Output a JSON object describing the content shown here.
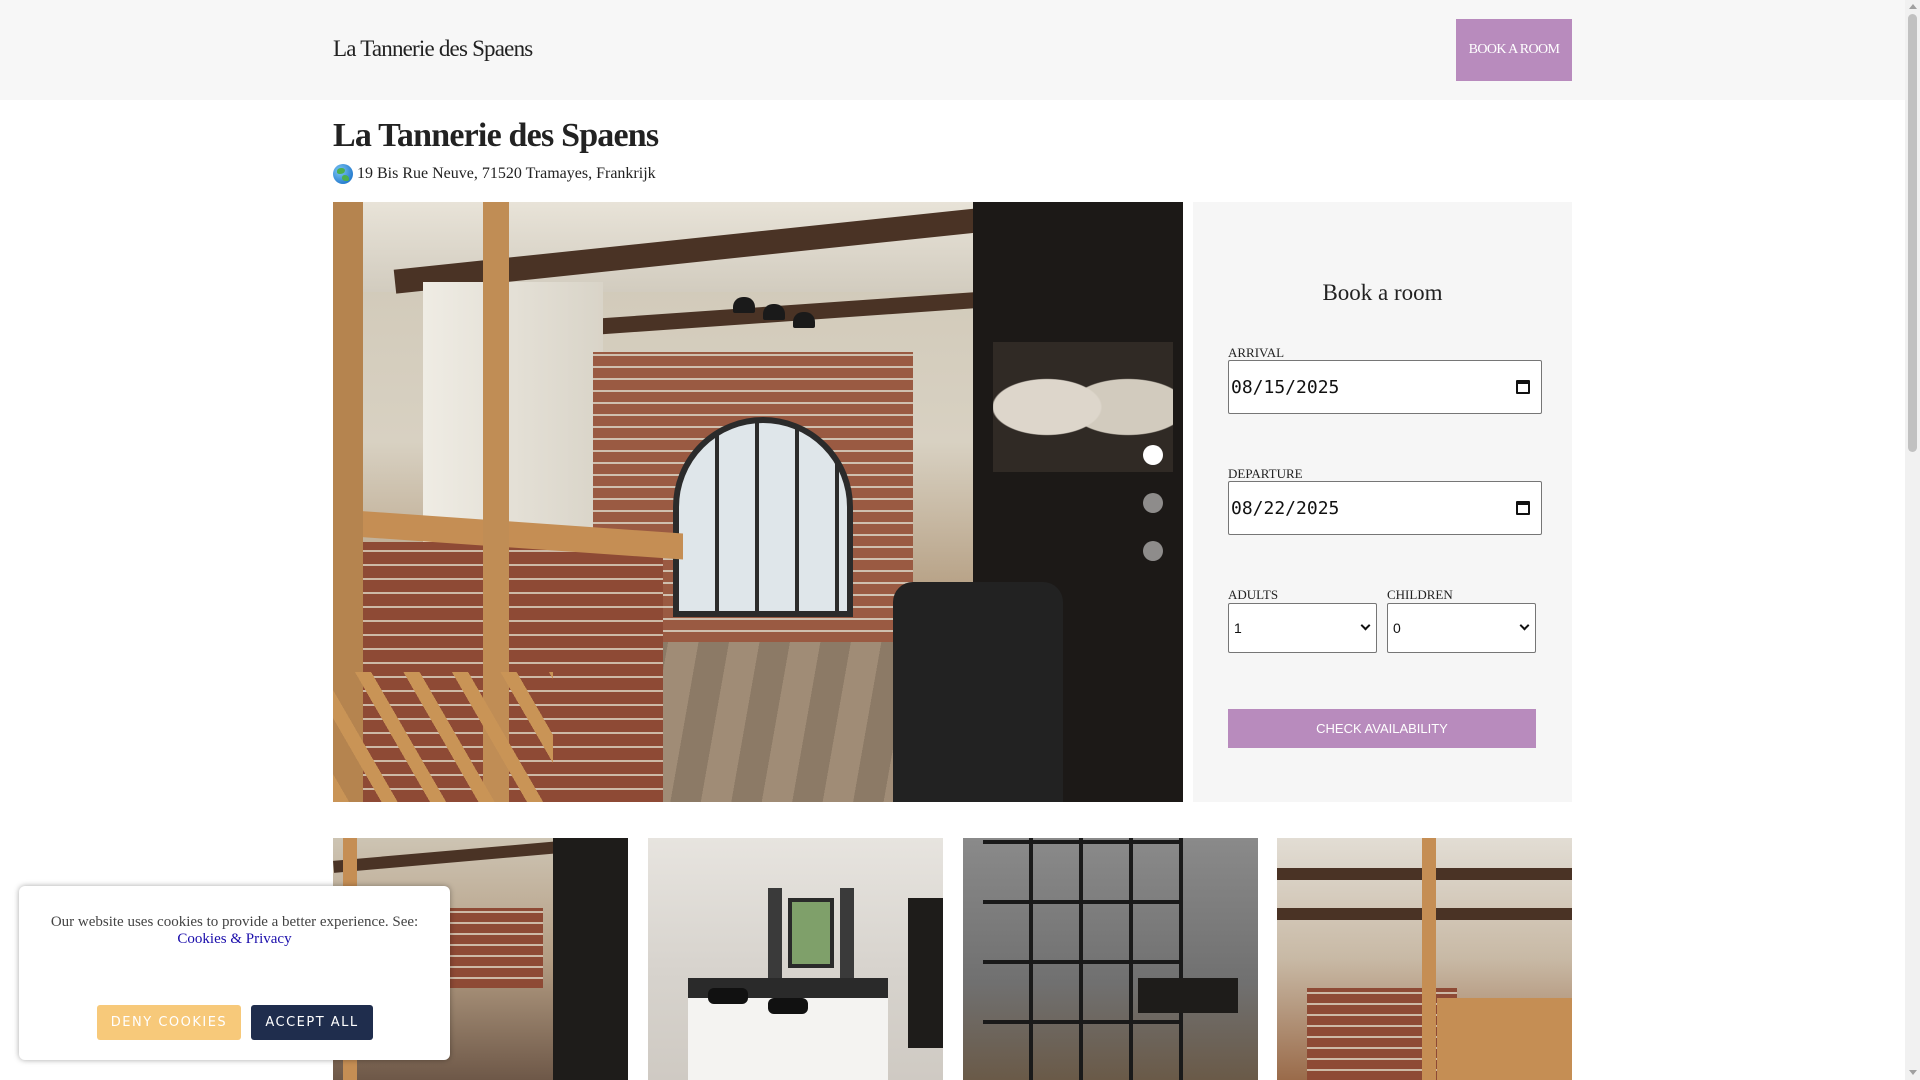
{
  "header": {
    "brand": "La Tannerie des Spaens",
    "book_button": "BOOK A ROOM"
  },
  "property": {
    "title": "La Tannerie des Spaens",
    "address": "19 Bis Rue Neuve, 71520 Tramayes, Frankrijk",
    "address_icon": "globe-icon"
  },
  "gallery": {
    "slide_count": 3,
    "active_slide": 1,
    "thumbnail_count": 4
  },
  "booking": {
    "title": "Book a room",
    "arrival_label": "ARRIVAL",
    "arrival_value": "08/15/2025",
    "departure_label": "DEPARTURE",
    "departure_value": "08/22/2025",
    "adults_label": "ADULTS",
    "adults_value": "1",
    "children_label": "CHILDREN",
    "children_value": "0",
    "check_button": "CHECK AVAILABILITY",
    "accent_color": "#b88bbd"
  },
  "cookie_banner": {
    "text": "Our website uses cookies to provide a better experience. See:",
    "link": "Cookies & Privacy",
    "deny_button": "DENY COOKIES",
    "accept_button": "ACCEPT ALL",
    "deny_color": "#f7c97a",
    "accept_color": "#1f2d4d"
  }
}
